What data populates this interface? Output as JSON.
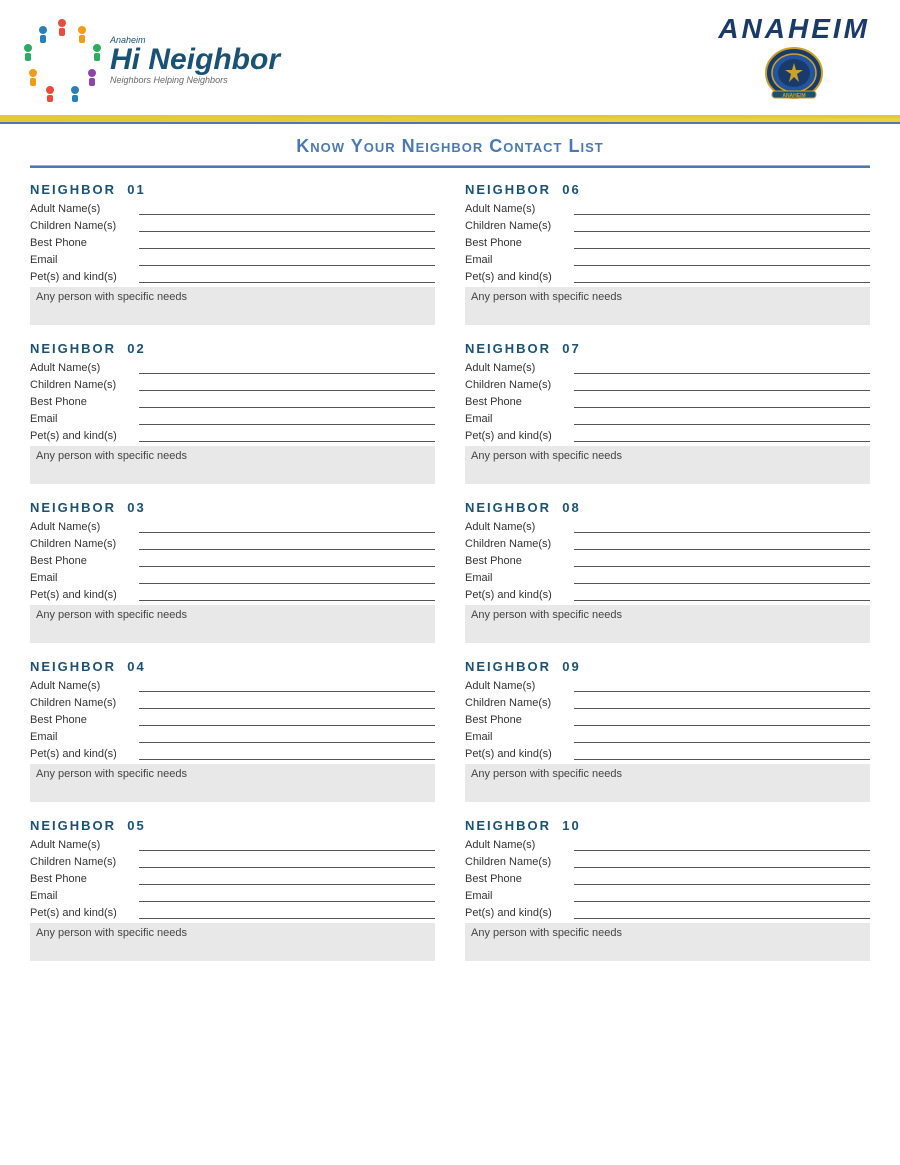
{
  "header": {
    "logo_left_anaheim": "Anaheim",
    "logo_left_hi": "Hi Neighbor",
    "logo_left_sub": "Neighbors Helping Neighbors",
    "logo_right": "ANAHEIM"
  },
  "title": "Know Your Neighbor Contact List",
  "neighbors": [
    {
      "id": "01",
      "fields": [
        "Adult Name(s)",
        "Children Name(s)",
        "Best Phone",
        "Email",
        "Pet(s) and kind(s)"
      ],
      "needs": "Any person with specific needs"
    },
    {
      "id": "02",
      "fields": [
        "Adult Name(s)",
        "Children Name(s)",
        "Best Phone",
        "Email",
        "Pet(s) and kind(s)"
      ],
      "needs": "Any person with specific needs"
    },
    {
      "id": "03",
      "fields": [
        "Adult Name(s)",
        "Children Name(s)",
        "Best Phone",
        "Email",
        "Pet(s) and kind(s)"
      ],
      "needs": "Any person with specific needs"
    },
    {
      "id": "04",
      "fields": [
        "Adult Name(s)",
        "Children Name(s)",
        "Best Phone",
        "Email",
        "Pet(s) and kind(s)"
      ],
      "needs": "Any person with specific needs"
    },
    {
      "id": "05",
      "fields": [
        "Adult Name(s)",
        "Children Name(s)",
        "Best Phone",
        "Email",
        "Pet(s) and kind(s)"
      ],
      "needs": "Any person with specific needs"
    },
    {
      "id": "06",
      "fields": [
        "Adult Name(s)",
        "Children Name(s)",
        "Best Phone",
        "Email",
        "Pet(s) and kind(s)"
      ],
      "needs": "Any person with specific needs"
    },
    {
      "id": "07",
      "fields": [
        "Adult Name(s)",
        "Children Name(s)",
        "Best Phone",
        "Email",
        "Pet(s) and kind(s)"
      ],
      "needs": "Any person with specific needs"
    },
    {
      "id": "08",
      "fields": [
        "Adult Name(s)",
        "Children Name(s)",
        "Best Phone",
        "Email",
        "Pet(s) and kind(s)"
      ],
      "needs": "Any person with specific needs"
    },
    {
      "id": "09",
      "fields": [
        "Adult Name(s)",
        "Children Name(s)",
        "Best Phone",
        "Email",
        "Pet(s) and kind(s)"
      ],
      "needs": "Any person with specific needs"
    },
    {
      "id": "10",
      "fields": [
        "Adult Name(s)",
        "Children Name(s)",
        "Best Phone",
        "Email",
        "Pet(s) and kind(s)"
      ],
      "needs": "Any person with specific needs"
    }
  ],
  "colors": {
    "neighbor_title": "#1a5276",
    "page_title": "#4a7ab5",
    "needs_bg": "#e8e8e8"
  }
}
